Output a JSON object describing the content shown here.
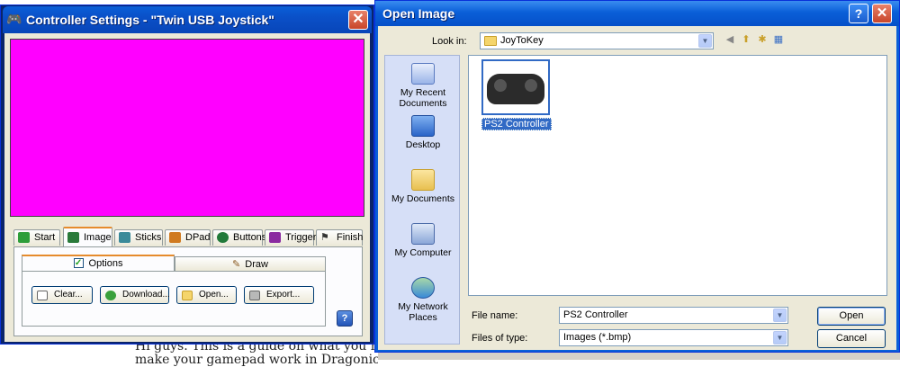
{
  "background": {
    "text_line1": "Hi guys. This is a guide on what you n",
    "text_line2": "make your gamepad work in Dragonica :D"
  },
  "controller_settings": {
    "title": "Controller Settings - \"Twin USB Joystick\"",
    "close_label": "✕",
    "image_color": "#ff00ff",
    "tabs": [
      {
        "label": "Start",
        "icon": "arrow-right-icon",
        "color": "#2e9e3a"
      },
      {
        "label": "Image",
        "icon": "image-icon",
        "color": "#2a7a3a"
      },
      {
        "label": "Sticks",
        "icon": "sticks-icon",
        "color": "#3a8a9a"
      },
      {
        "label": "DPad",
        "icon": "dpad-icon",
        "color": "#d07a20"
      },
      {
        "label": "Buttons",
        "icon": "buttons-icon",
        "color": "#227a3a"
      },
      {
        "label": "Triggers",
        "icon": "triggers-icon",
        "color": "#8a2aa0"
      },
      {
        "label": "Finish",
        "icon": "finish-flag-icon",
        "color": "#555555"
      }
    ],
    "active_tab": "Image",
    "subtabs": {
      "options_label": "Options",
      "options_checked": true,
      "draw_label": "Draw"
    },
    "buttons": {
      "clear": "Clear...",
      "download": "Download...",
      "open": "Open...",
      "export": "Export..."
    },
    "help_label": "?"
  },
  "open_image": {
    "title": "Open Image",
    "help_label": "?",
    "close_label": "✕",
    "look_in_label": "Look in:",
    "look_in_value": "JoyToKey",
    "places": [
      {
        "label": "My Recent Documents",
        "icon": "recent-documents-icon"
      },
      {
        "label": "Desktop",
        "icon": "desktop-icon"
      },
      {
        "label": "My Documents",
        "icon": "my-documents-icon"
      },
      {
        "label": "My Computer",
        "icon": "my-computer-icon"
      },
      {
        "label": "My Network Places",
        "icon": "network-places-icon"
      }
    ],
    "files": [
      {
        "name": "PS2 Controller",
        "selected": true
      }
    ],
    "file_name_label": "File name:",
    "file_name_value": "PS2 Controller",
    "files_of_type_label": "Files of type:",
    "files_of_type_value": "Images (*.bmp)",
    "open_button": "Open",
    "cancel_button": "Cancel"
  }
}
